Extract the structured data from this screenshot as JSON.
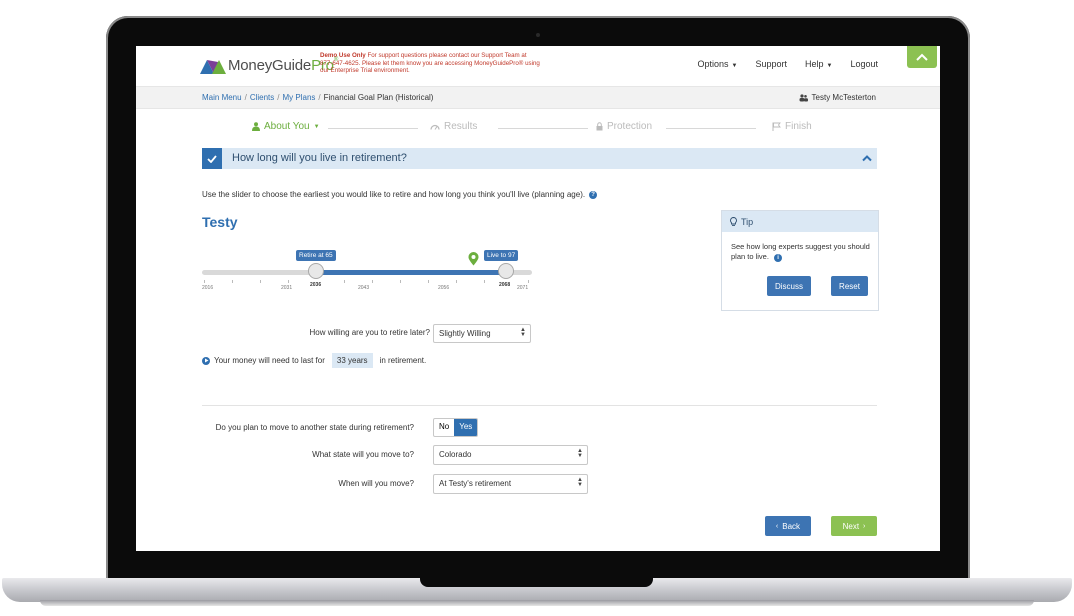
{
  "app": {
    "logo_main": "MoneyGuide",
    "logo_accent": "Pro",
    "logo_reg": "®"
  },
  "demo_notice": {
    "bold": "Demo Use Only",
    "text": " For support questions please contact our Support Team at 877-647-4625. Please let them know you are accessing MoneyGuidePro® using our Enterprise Trial environment."
  },
  "nav": {
    "options": "Options",
    "support": "Support",
    "help": "Help",
    "logout": "Logout"
  },
  "breadcrumb": {
    "main_menu": "Main Menu",
    "clients": "Clients",
    "my_plans": "My Plans",
    "current": "Financial Goal Plan (Historical)",
    "sep": "/"
  },
  "user": {
    "name": "Testy McTesterton"
  },
  "stepper": {
    "about_you": "About You",
    "results": "Results",
    "protection": "Protection",
    "finish": "Finish"
  },
  "section": {
    "title": "How long will you live in retirement?",
    "intro": "Use the slider to choose the earliest you would like to retire and how long you think you'll live (planning age)."
  },
  "person": {
    "name": "Testy"
  },
  "slider": {
    "retire_label": "Retire at 65",
    "live_label": "Live to 97",
    "retire_year": "2036",
    "live_year": "2068",
    "years": [
      "2016",
      "2031",
      "2036",
      "2043",
      "2056",
      "2068",
      "2071"
    ]
  },
  "willing": {
    "label": "How willing are you to retire later?",
    "value": "Slightly Willing"
  },
  "money": {
    "prefix": "Your money will need to last for",
    "value": "33 years",
    "suffix": "in retirement."
  },
  "move": {
    "question": "Do you plan to move to another state during retirement?",
    "no": "No",
    "yes": "Yes",
    "state_label": "What state will you move to?",
    "state_value": "Colorado",
    "when_label": "When will you move?",
    "when_value": "At Testy's retirement"
  },
  "buttons": {
    "back": "Back",
    "next": "Next"
  },
  "tip": {
    "title": "Tip",
    "text": "See how long experts suggest you should plan to live.",
    "discuss": "Discuss",
    "reset": "Reset"
  },
  "colors": {
    "primary_blue": "#2f6fb0",
    "accent_green": "#8cc152",
    "header_bg": "#dbe8f4"
  }
}
